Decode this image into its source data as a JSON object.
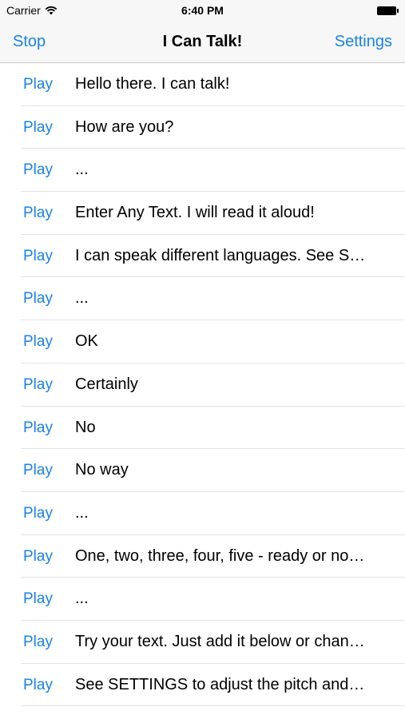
{
  "status_bar": {
    "carrier": "Carrier",
    "time": "6:40 PM",
    "icons": [
      "wifi-icon",
      "battery-icon"
    ]
  },
  "nav": {
    "left_label": "Stop",
    "title": "I Can Talk!",
    "right_label": "Settings",
    "accent": "#1a82e6"
  },
  "rows": [
    {
      "action": "Play",
      "text": "Hello there. I can talk!"
    },
    {
      "action": "Play",
      "text": "How are you?"
    },
    {
      "action": "Play",
      "text": "..."
    },
    {
      "action": "Play",
      "text": "Enter Any Text. I will read it aloud!"
    },
    {
      "action": "Play",
      "text": "I can speak different languages. See S…"
    },
    {
      "action": "Play",
      "text": "..."
    },
    {
      "action": "Play",
      "text": "OK"
    },
    {
      "action": "Play",
      "text": "Certainly"
    },
    {
      "action": "Play",
      "text": "No"
    },
    {
      "action": "Play",
      "text": "No way"
    },
    {
      "action": "Play",
      "text": "..."
    },
    {
      "action": "Play",
      "text": "One, two, three, four, five - ready or no…"
    },
    {
      "action": "Play",
      "text": "..."
    },
    {
      "action": "Play",
      "text": "Try your text. Just add it below or chan…"
    },
    {
      "action": "Play",
      "text": "See SETTINGS to adjust the pitch and…"
    }
  ]
}
